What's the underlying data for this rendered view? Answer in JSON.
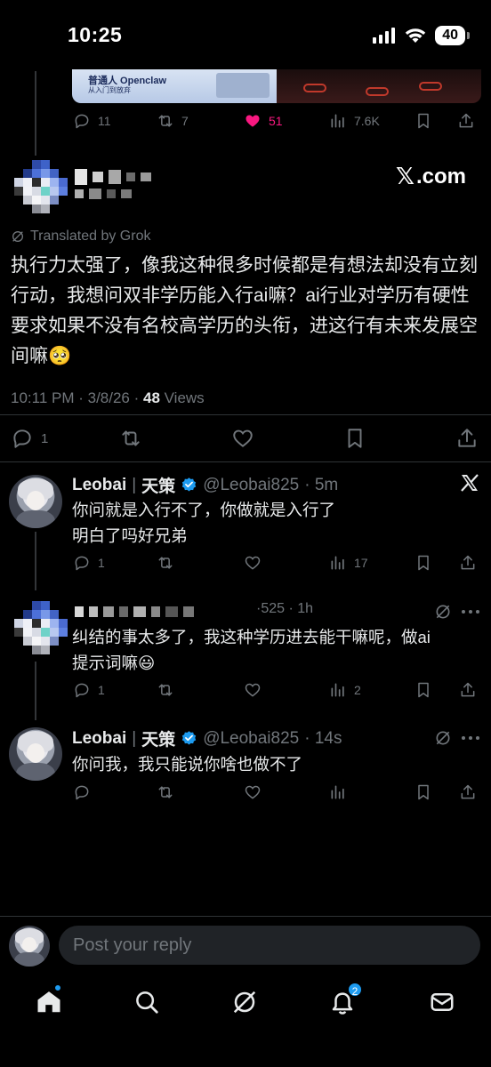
{
  "status_bar": {
    "time": "10:25",
    "battery": "40"
  },
  "quoted_media": {
    "title": "普通人 Openclaw",
    "subtitle": "从入门到放弃"
  },
  "top_actions": {
    "replies": "11",
    "reposts": "7",
    "likes": "51",
    "views": "7.6K"
  },
  "brand": {
    "x_glyph": "𝕏",
    "label": ".com"
  },
  "main_post": {
    "translated": "Translated by Grok",
    "text": "执行力太强了，像我这种很多时候都是有想法却没有立刻行动，我想问双非学历能入行ai嘛？ai行业对学历有硬性要求如果不没有名校高学历的头衔，进这行有未来发展空间嘛🥺",
    "time": "10:11 PM · 3/8/26 · ",
    "views_count": "48",
    "views_label": " Views",
    "replies": "1"
  },
  "reply1": {
    "name": "Leobai",
    "sep": "|",
    "tag": "天策",
    "handle": "@Leobai825",
    "time": "· 5m",
    "line1": "你问就是入行不了，你做就是入行了",
    "line2": "明白了吗好兄弟",
    "replies": "1",
    "views": "17"
  },
  "reply2": {
    "partial_handle": "·525 · 1h",
    "line1": "纠结的事太多了，我这种学历进去能干嘛呢，做ai",
    "line2": "提示词嘛😃",
    "replies": "1",
    "views": "2"
  },
  "reply3": {
    "name": "Leobai",
    "sep": "|",
    "tag": "天策",
    "handle": "@Leobai825",
    "time": "· 14s",
    "line1": "你问我，我只能说你啥也做不了"
  },
  "composer": {
    "placeholder": "Post your reply"
  },
  "nav": {
    "notifications_badge": "2"
  },
  "colors": {
    "accent": "#1d9bf0",
    "like": "#f91880",
    "muted": "#71767b"
  }
}
